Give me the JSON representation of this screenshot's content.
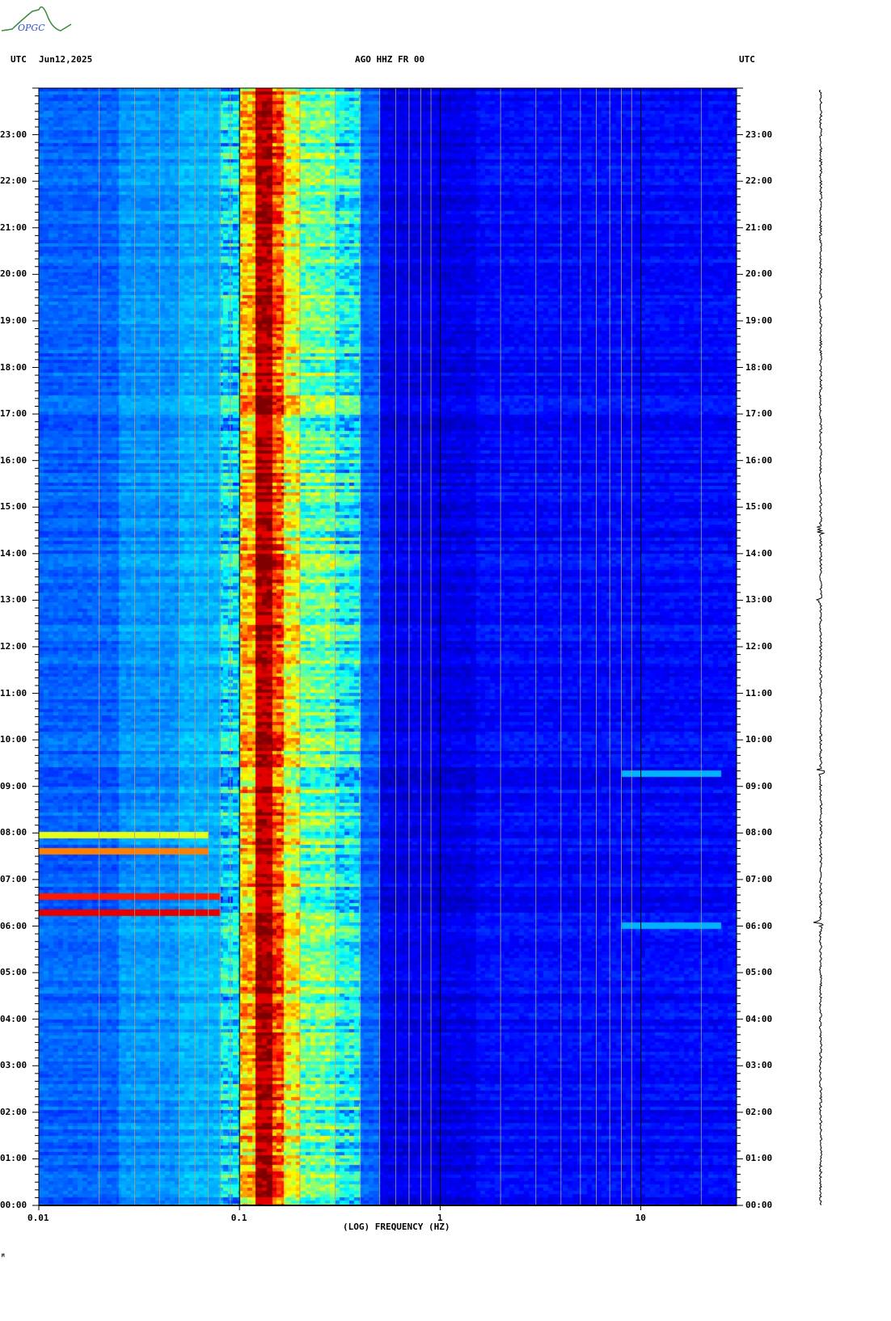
{
  "header": {
    "left_tz": "UTC",
    "date": "Jun12,2025",
    "station": "AGO HHZ FR 00",
    "right_tz": "UTC"
  },
  "logo_text": "OPGC",
  "footer_mark": "M",
  "chart_data": {
    "type": "heatmap",
    "title": "AGO HHZ FR 00",
    "xlabel": "(LOG) FREQUENCY (HZ)",
    "xscale": "log",
    "xlim": [
      0.01,
      30
    ],
    "xticks": [
      {
        "v": 0.01,
        "label": "0.01"
      },
      {
        "v": 0.1,
        "label": "0.1"
      },
      {
        "v": 1,
        "label": "1"
      },
      {
        "v": 10,
        "label": "10"
      }
    ],
    "ylabel": "UTC",
    "ylim_hours": [
      0,
      24
    ],
    "yticks": [
      "00:00",
      "01:00",
      "02:00",
      "03:00",
      "04:00",
      "05:00",
      "06:00",
      "07:00",
      "08:00",
      "09:00",
      "10:00",
      "11:00",
      "12:00",
      "13:00",
      "14:00",
      "15:00",
      "16:00",
      "17:00",
      "18:00",
      "19:00",
      "20:00",
      "21:00",
      "22:00",
      "23:00"
    ],
    "colormap": "jet",
    "spectral_profile": [
      [
        0.01,
        0.22
      ],
      [
        0.025,
        0.27
      ],
      [
        0.05,
        0.3
      ],
      [
        0.08,
        0.35
      ],
      [
        0.1,
        0.68
      ],
      [
        0.12,
        0.95
      ],
      [
        0.145,
        0.8
      ],
      [
        0.165,
        0.6
      ],
      [
        0.2,
        0.47
      ],
      [
        0.3,
        0.38
      ],
      [
        0.4,
        0.22
      ],
      [
        0.5,
        0.1
      ],
      [
        1.5,
        0.13
      ]
    ],
    "events": [
      {
        "hour": 6.3,
        "fmin": 0.01,
        "fmax": 0.08,
        "level": 0.9
      },
      {
        "hour": 6.7,
        "fmin": 0.01,
        "fmax": 0.08,
        "level": 0.85
      },
      {
        "hour": 7.65,
        "fmin": 0.01,
        "fmax": 0.07,
        "level": 0.75
      },
      {
        "hour": 8.0,
        "fmin": 0.01,
        "fmax": 0.07,
        "level": 0.6
      },
      {
        "hour": 6.05,
        "fmin": 8,
        "fmax": 25,
        "level": 0.3
      },
      {
        "hour": 9.3,
        "fmin": 8,
        "fmax": 25,
        "level": 0.3
      }
    ],
    "trace_events_hours": [
      6.05,
      9.3,
      13.0,
      14.5
    ]
  }
}
